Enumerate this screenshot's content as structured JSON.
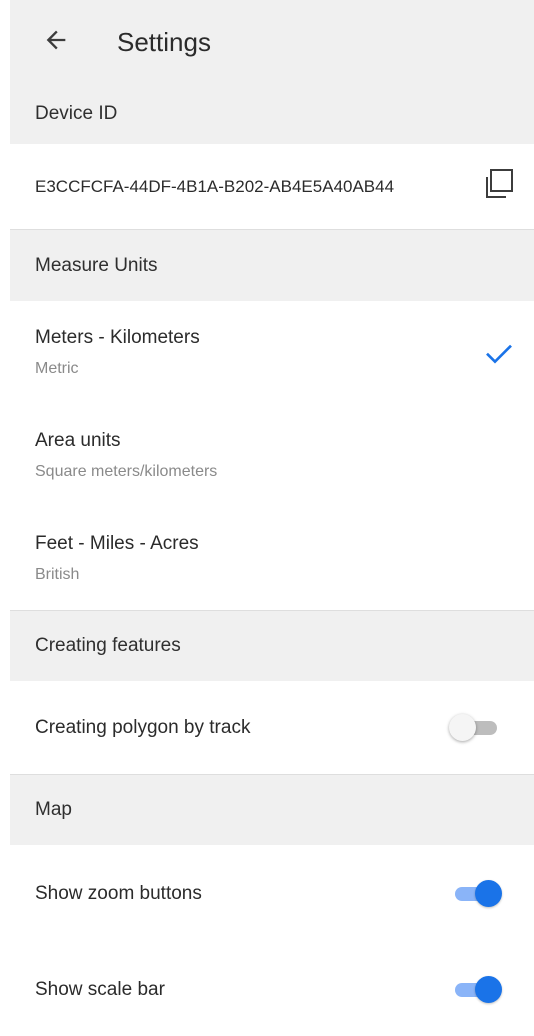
{
  "header": {
    "title": "Settings",
    "back_icon": "arrow-left-icon"
  },
  "device_section": {
    "title": "Device ID",
    "device_id": "E3CCFCFA-44DF-4B1A-B202-AB4E5A40AB44",
    "copy_icon": "copy-icon"
  },
  "units_section": {
    "title": "Measure Units",
    "options": [
      {
        "title": "Meters - Kilometers",
        "subtitle": "Metric",
        "selected": true
      },
      {
        "title": "Area units",
        "subtitle": "Square meters/kilometers",
        "selected": false
      },
      {
        "title": "Feet - Miles - Acres",
        "subtitle": "British",
        "selected": false
      }
    ]
  },
  "features_section": {
    "title": "Creating features",
    "items": [
      {
        "label": "Creating polygon by track",
        "enabled": false
      }
    ]
  },
  "map_section": {
    "title": "Map",
    "items": [
      {
        "label": "Show zoom buttons",
        "enabled": true
      },
      {
        "label": "Show scale bar",
        "enabled": true
      }
    ]
  },
  "colors": {
    "accent": "#1a73e8",
    "header_background": "#f0f0f0",
    "divider": "#dedede"
  }
}
